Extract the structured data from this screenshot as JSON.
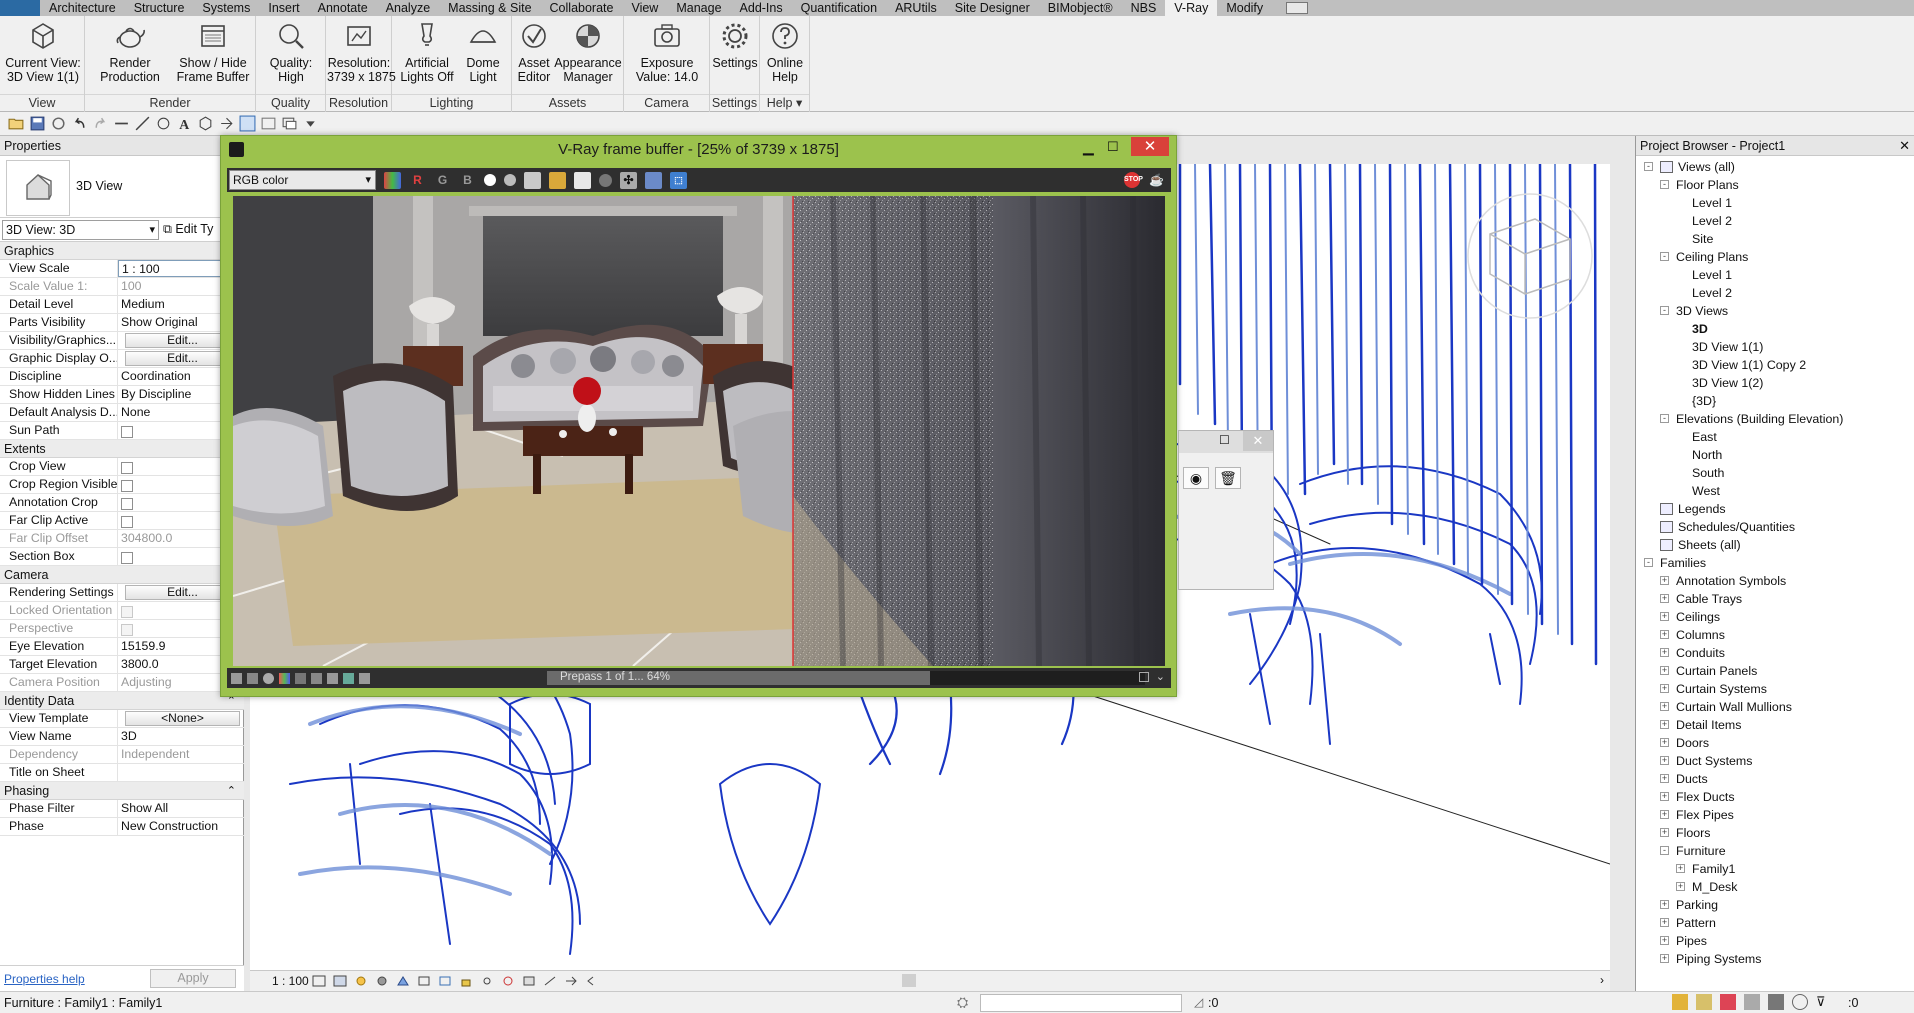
{
  "menubar": {
    "tabs": [
      "Architecture",
      "Structure",
      "Systems",
      "Insert",
      "Annotate",
      "Analyze",
      "Massing & Site",
      "Collaborate",
      "View",
      "Manage",
      "Add-Ins",
      "Quantification",
      "ARUtils",
      "Site Designer",
      "BIMobject®",
      "NBS",
      "V-Ray",
      "Modify"
    ],
    "active_tab": "V-Ray"
  },
  "ribbon": {
    "groups": {
      "view": "View",
      "render": "Render",
      "quality": "Quality",
      "resolution": "Resolution",
      "lighting": "Lighting",
      "assets": "Assets",
      "camera": "Camera",
      "settings": "Settings",
      "help": "Help"
    },
    "buttons": {
      "current_view": [
        "Current View:",
        "3D View 1(1)"
      ],
      "render_production": [
        "Render",
        "Production"
      ],
      "frame_buffer": [
        "Show / Hide",
        "Frame Buffer"
      ],
      "quality": [
        "Quality:",
        "High"
      ],
      "resolution": [
        "Resolution:",
        "3739 x 1875"
      ],
      "artificial_lights": [
        "Artificial",
        "Lights Off"
      ],
      "dome_light": [
        "Dome",
        "Light"
      ],
      "asset_editor": [
        "Asset",
        "Editor"
      ],
      "appearance_manager": [
        "Appearance",
        "Manager"
      ],
      "exposure": [
        "Exposure",
        "Value: 14.0"
      ],
      "settings": [
        "Settings"
      ],
      "online_help": [
        "Online",
        "Help"
      ]
    }
  },
  "properties": {
    "title": "Properties",
    "type_name": "3D View",
    "view_selector": "3D View: 3D",
    "edit_type": "Edit Ty",
    "sections": [
      {
        "name": "Graphics",
        "rows": [
          {
            "name": "View Scale",
            "value": "1 : 100",
            "kind": "input"
          },
          {
            "name": "Scale Value    1:",
            "value": "100",
            "kind": "dim"
          },
          {
            "name": "Detail Level",
            "value": "Medium"
          },
          {
            "name": "Parts Visibility",
            "value": "Show Original"
          },
          {
            "name": "Visibility/Graphics...",
            "value": "Edit...",
            "kind": "button"
          },
          {
            "name": "Graphic Display O...",
            "value": "Edit...",
            "kind": "button"
          },
          {
            "name": "Discipline",
            "value": "Coordination"
          },
          {
            "name": "Show Hidden Lines",
            "value": "By Discipline"
          },
          {
            "name": "Default Analysis D...",
            "value": "None"
          },
          {
            "name": "Sun Path",
            "value": "",
            "kind": "check"
          }
        ]
      },
      {
        "name": "Extents",
        "rows": [
          {
            "name": "Crop View",
            "value": "",
            "kind": "check"
          },
          {
            "name": "Crop Region Visible",
            "value": "",
            "kind": "check"
          },
          {
            "name": "Annotation Crop",
            "value": "",
            "kind": "check"
          },
          {
            "name": "Far Clip Active",
            "value": "",
            "kind": "check"
          },
          {
            "name": "Far Clip Offset",
            "value": "304800.0",
            "kind": "dim"
          },
          {
            "name": "Section Box",
            "value": "",
            "kind": "check"
          }
        ]
      },
      {
        "name": "Camera",
        "rows": [
          {
            "name": "Rendering Settings",
            "value": "Edit...",
            "kind": "button"
          },
          {
            "name": "Locked Orientation",
            "value": "",
            "kind": "dimcheck"
          },
          {
            "name": "Perspective",
            "value": "",
            "kind": "dimcheck"
          },
          {
            "name": "Eye Elevation",
            "value": "15159.9"
          },
          {
            "name": "Target Elevation",
            "value": "3800.0"
          },
          {
            "name": "Camera Position",
            "value": "Adjusting",
            "kind": "dim"
          }
        ]
      },
      {
        "name": "Identity Data",
        "collapse": "⌃",
        "rows": [
          {
            "name": "View Template",
            "value": "<None>",
            "kind": "button"
          },
          {
            "name": "View Name",
            "value": "3D"
          },
          {
            "name": "Dependency",
            "value": "Independent",
            "kind": "dim"
          },
          {
            "name": "Title on Sheet",
            "value": ""
          }
        ]
      },
      {
        "name": "Phasing",
        "collapse": "⌃",
        "rows": [
          {
            "name": "Phase Filter",
            "value": "Show All"
          },
          {
            "name": "Phase",
            "value": "New Construction"
          }
        ]
      }
    ],
    "help_link": "Properties help",
    "apply": "Apply"
  },
  "viewbar": {
    "scale": "1 : 100"
  },
  "vfb": {
    "title": "V-Ray frame buffer - [25% of 3739 x 1875]",
    "channel": "RGB color",
    "channel_buttons": [
      "R",
      "G",
      "B"
    ],
    "progress_text": "Prepass 1 of 1... 64%",
    "progress": 0.64,
    "close": "✕"
  },
  "browser": {
    "title": "Project Browser - Project1",
    "close": "✕",
    "items": [
      {
        "label": "Views (all)",
        "level": 0,
        "exp": "-",
        "icon": true
      },
      {
        "label": "Floor Plans",
        "level": 1,
        "exp": "-"
      },
      {
        "label": "Level 1",
        "level": 2
      },
      {
        "label": "Level 2",
        "level": 2
      },
      {
        "label": "Site",
        "level": 2
      },
      {
        "label": "Ceiling Plans",
        "level": 1,
        "exp": "-"
      },
      {
        "label": "Level 1",
        "level": 2
      },
      {
        "label": "Level 2",
        "level": 2
      },
      {
        "label": "3D Views",
        "level": 1,
        "exp": "-"
      },
      {
        "label": "3D",
        "level": 2,
        "bold": true
      },
      {
        "label": "3D View 1(1)",
        "level": 2
      },
      {
        "label": "3D View 1(1) Copy 2",
        "level": 2
      },
      {
        "label": "3D View 1(2)",
        "level": 2
      },
      {
        "label": "{3D}",
        "level": 2
      },
      {
        "label": "Elevations (Building Elevation)",
        "level": 1,
        "exp": "-"
      },
      {
        "label": "East",
        "level": 2
      },
      {
        "label": "North",
        "level": 2
      },
      {
        "label": "South",
        "level": 2
      },
      {
        "label": "West",
        "level": 2
      },
      {
        "label": "Legends",
        "level": 0,
        "icon": true
      },
      {
        "label": "Schedules/Quantities",
        "level": 0,
        "icon": true
      },
      {
        "label": "Sheets (all)",
        "level": 0,
        "icon": true
      },
      {
        "label": "Families",
        "level": 0,
        "exp": "-"
      },
      {
        "label": "Annotation Symbols",
        "level": 1,
        "exp": "+"
      },
      {
        "label": "Cable Trays",
        "level": 1,
        "exp": "+"
      },
      {
        "label": "Ceilings",
        "level": 1,
        "exp": "+"
      },
      {
        "label": "Columns",
        "level": 1,
        "exp": "+"
      },
      {
        "label": "Conduits",
        "level": 1,
        "exp": "+"
      },
      {
        "label": "Curtain Panels",
        "level": 1,
        "exp": "+"
      },
      {
        "label": "Curtain Systems",
        "level": 1,
        "exp": "+"
      },
      {
        "label": "Curtain Wall Mullions",
        "level": 1,
        "exp": "+"
      },
      {
        "label": "Detail Items",
        "level": 1,
        "exp": "+"
      },
      {
        "label": "Doors",
        "level": 1,
        "exp": "+"
      },
      {
        "label": "Duct Systems",
        "level": 1,
        "exp": "+"
      },
      {
        "label": "Ducts",
        "level": 1,
        "exp": "+"
      },
      {
        "label": "Flex Ducts",
        "level": 1,
        "exp": "+"
      },
      {
        "label": "Flex Pipes",
        "level": 1,
        "exp": "+"
      },
      {
        "label": "Floors",
        "level": 1,
        "exp": "+"
      },
      {
        "label": "Furniture",
        "level": 1,
        "exp": "-"
      },
      {
        "label": "Family1",
        "level": 2,
        "exp": "+"
      },
      {
        "label": "M_Desk",
        "level": 2,
        "exp": "+"
      },
      {
        "label": "Parking",
        "level": 1,
        "exp": "+"
      },
      {
        "label": "Pattern",
        "level": 1,
        "exp": "+"
      },
      {
        "label": "Pipes",
        "level": 1,
        "exp": "+"
      },
      {
        "label": "Piping Systems",
        "level": 1,
        "exp": "+"
      }
    ]
  },
  "statusbar": {
    "text": "Furniture : Family1 : Family1",
    "selection_count": ":0",
    "filter_count": ":0"
  },
  "colors": {
    "vfb_frame": "#9cc24d",
    "wire_blue": "#1a37c4",
    "wire_light": "#6f8fd8"
  }
}
